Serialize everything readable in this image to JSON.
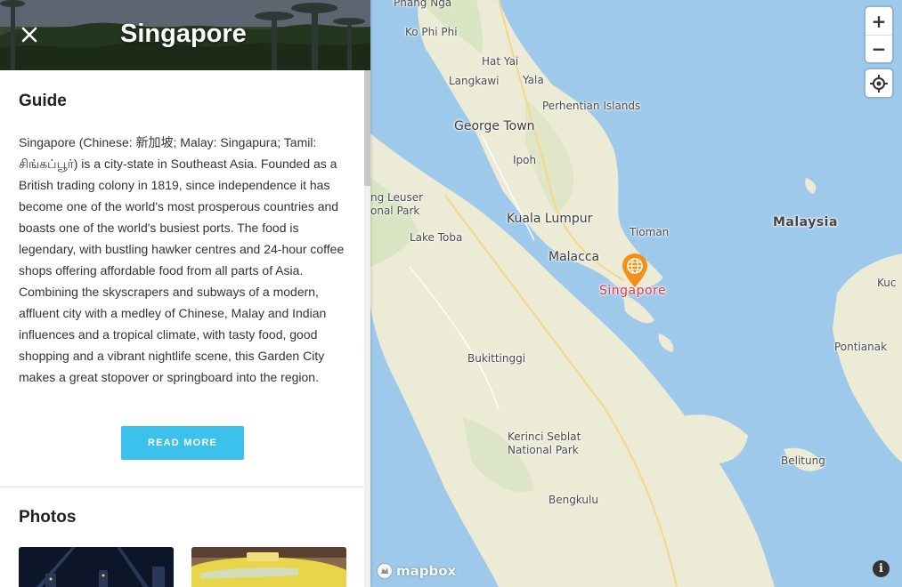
{
  "sidebar": {
    "title": "Singapore",
    "guide_heading": "Guide",
    "guide_text": "Singapore (Chinese: 新加坡; Malay: Singapura; Tamil: சிங்கப்பூர்) is a city-state in Southeast Asia. Founded as a British trading colony in 1819, since independence it has become one of the world's most prosperous countries and boasts one of the world's busiest ports. The food is legendary, with bustling hawker centres and 24-hour coffee shops offering affordable food from all parts of Asia. Combining the skyscrapers and subways of a modern, affluent city with a medley of Chinese, Malay and Indian influences and a tropical climate, with tasty food, good shopping and a vibrant nightlife scene, this Garden City makes a great stopover or springboard into the region.",
    "read_more_label": "READ MORE",
    "photos_heading": "Photos",
    "accent_color": "#3cc0ec"
  },
  "map": {
    "labels": {
      "phang_nga": "Phang Nga",
      "ko_phi_phi": "Ko Phi Phi",
      "hat_yai": "Hat Yai",
      "langkawi": "Langkawi",
      "yala": "Yala",
      "perhentian": "Perhentian Islands",
      "george_town": "George Town",
      "ipoh": "Ipoh",
      "gunung_leuser_1": "ng Leuser",
      "gunung_leuser_2": "onal Park",
      "kuala_lumpur": "Kuala Lumpur",
      "lake_toba": "Lake Toba",
      "tioman": "Tioman",
      "malaysia": "Malaysia",
      "malacca": "Malacca",
      "singapore": "Singapore",
      "kuching": "Kuc",
      "pontianak": "Pontianak",
      "bukittinggi": "Bukittinggi",
      "kerinci_1": "Kerinci Seblat",
      "kerinci_2": "National Park",
      "belitung": "Belitung",
      "bengkulu": "Bengkulu"
    },
    "zoom_in": "+",
    "zoom_out": "−",
    "attribution_logo": "mapbox",
    "info": "i",
    "marker_color": "#f39019",
    "selected_label_color": "#e0383b",
    "water_color": "#9fc9ea",
    "land_color": "#ecebd6"
  }
}
